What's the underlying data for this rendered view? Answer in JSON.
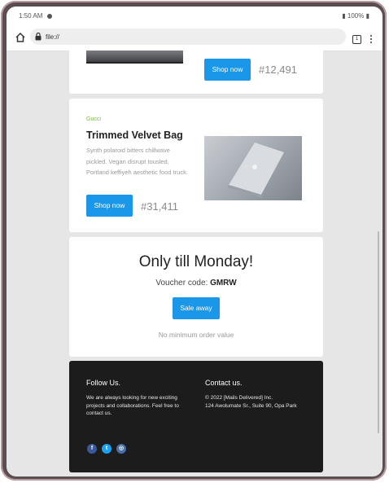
{
  "statusbar": {
    "time": "1:50 AM",
    "battery": "100%"
  },
  "browser": {
    "url": "file://",
    "tab_count": "1"
  },
  "product_card_1": {
    "button_label": "Shop now",
    "price": "#12,491"
  },
  "product_card_2": {
    "brand": "Gucci",
    "title": "Trimmed Velvet Bag",
    "description": "Synth polaroid bitters chillwave pickled. Vegan disrupt tousled, Portland keffiyeh aesthetic food truck.",
    "button_label": "Shop now",
    "price": "#31,411"
  },
  "promo": {
    "title": "Only till Monday!",
    "voucher_label": "Voucher code:",
    "voucher_code": "GMRW",
    "button_label": "Sale away",
    "note": "No minimum order value"
  },
  "footer": {
    "follow_heading": "Follow Us.",
    "follow_text": "We are always looking for new exciting projects and collaborations. Feel free to contact us.",
    "contact_heading": "Contact us.",
    "contact_line1": "© 2022 [Mails Delivered] Inc.",
    "contact_line2": "124 Awolumate Sr., Suite 90, Opa Park",
    "social": [
      "facebook-icon",
      "twitter-icon",
      "instagram-icon"
    ]
  },
  "colors": {
    "accent": "#1a97e8",
    "brand": "#78b84a",
    "footer_bg": "#1c1c1c"
  }
}
